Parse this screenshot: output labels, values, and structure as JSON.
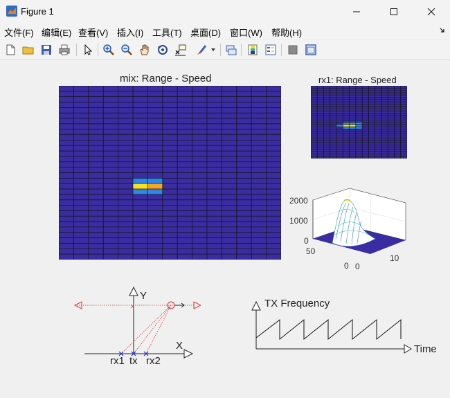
{
  "window": {
    "title": "Figure 1"
  },
  "menu": [
    {
      "label": "文件(F)"
    },
    {
      "label": "编辑(E)"
    },
    {
      "label": "查看(V)"
    },
    {
      "label": "插入(I)"
    },
    {
      "label": "工具(T)"
    },
    {
      "label": "桌面(D)"
    },
    {
      "label": "窗口(W)"
    },
    {
      "label": "帮助(H)"
    }
  ],
  "toolbar": {
    "icons": [
      "new-figure-icon",
      "open-file-icon",
      "save-icon",
      "print-icon",
      "edit-plot-arrow-icon",
      "zoom-in-icon",
      "zoom-out-icon",
      "pan-hand-icon",
      "rotate-3d-icon",
      "data-cursor-icon",
      "brush-icon",
      "link-plot-icon",
      "colorbar-icon",
      "legend-icon",
      "hide-plot-tools-icon",
      "show-plot-tools-icon"
    ]
  },
  "plots": {
    "mix": {
      "title": "mix: Range - Speed"
    },
    "rx1": {
      "title": "rx1: Range - Speed"
    },
    "surf": {
      "zticks": [
        "2000",
        "1000",
        "0"
      ],
      "yticks": [
        "50",
        "0"
      ],
      "xticks": [
        "0",
        "10"
      ]
    },
    "geometry": {
      "y_label": "Y",
      "x_label": "X",
      "rx1": "rx1",
      "tx": "tx",
      "rx2": "rx2"
    },
    "freq": {
      "y_label": "TX Frequency",
      "x_label": "Time"
    }
  },
  "colors": {
    "heatmap_bg": "#3a2ca1",
    "heat_yellow": "#f5e11d",
    "heat_orange": "#f5a623",
    "heat_blue": "#2f86e8",
    "accent_red": "#e03030",
    "accent_blue": "#2030c8"
  }
}
